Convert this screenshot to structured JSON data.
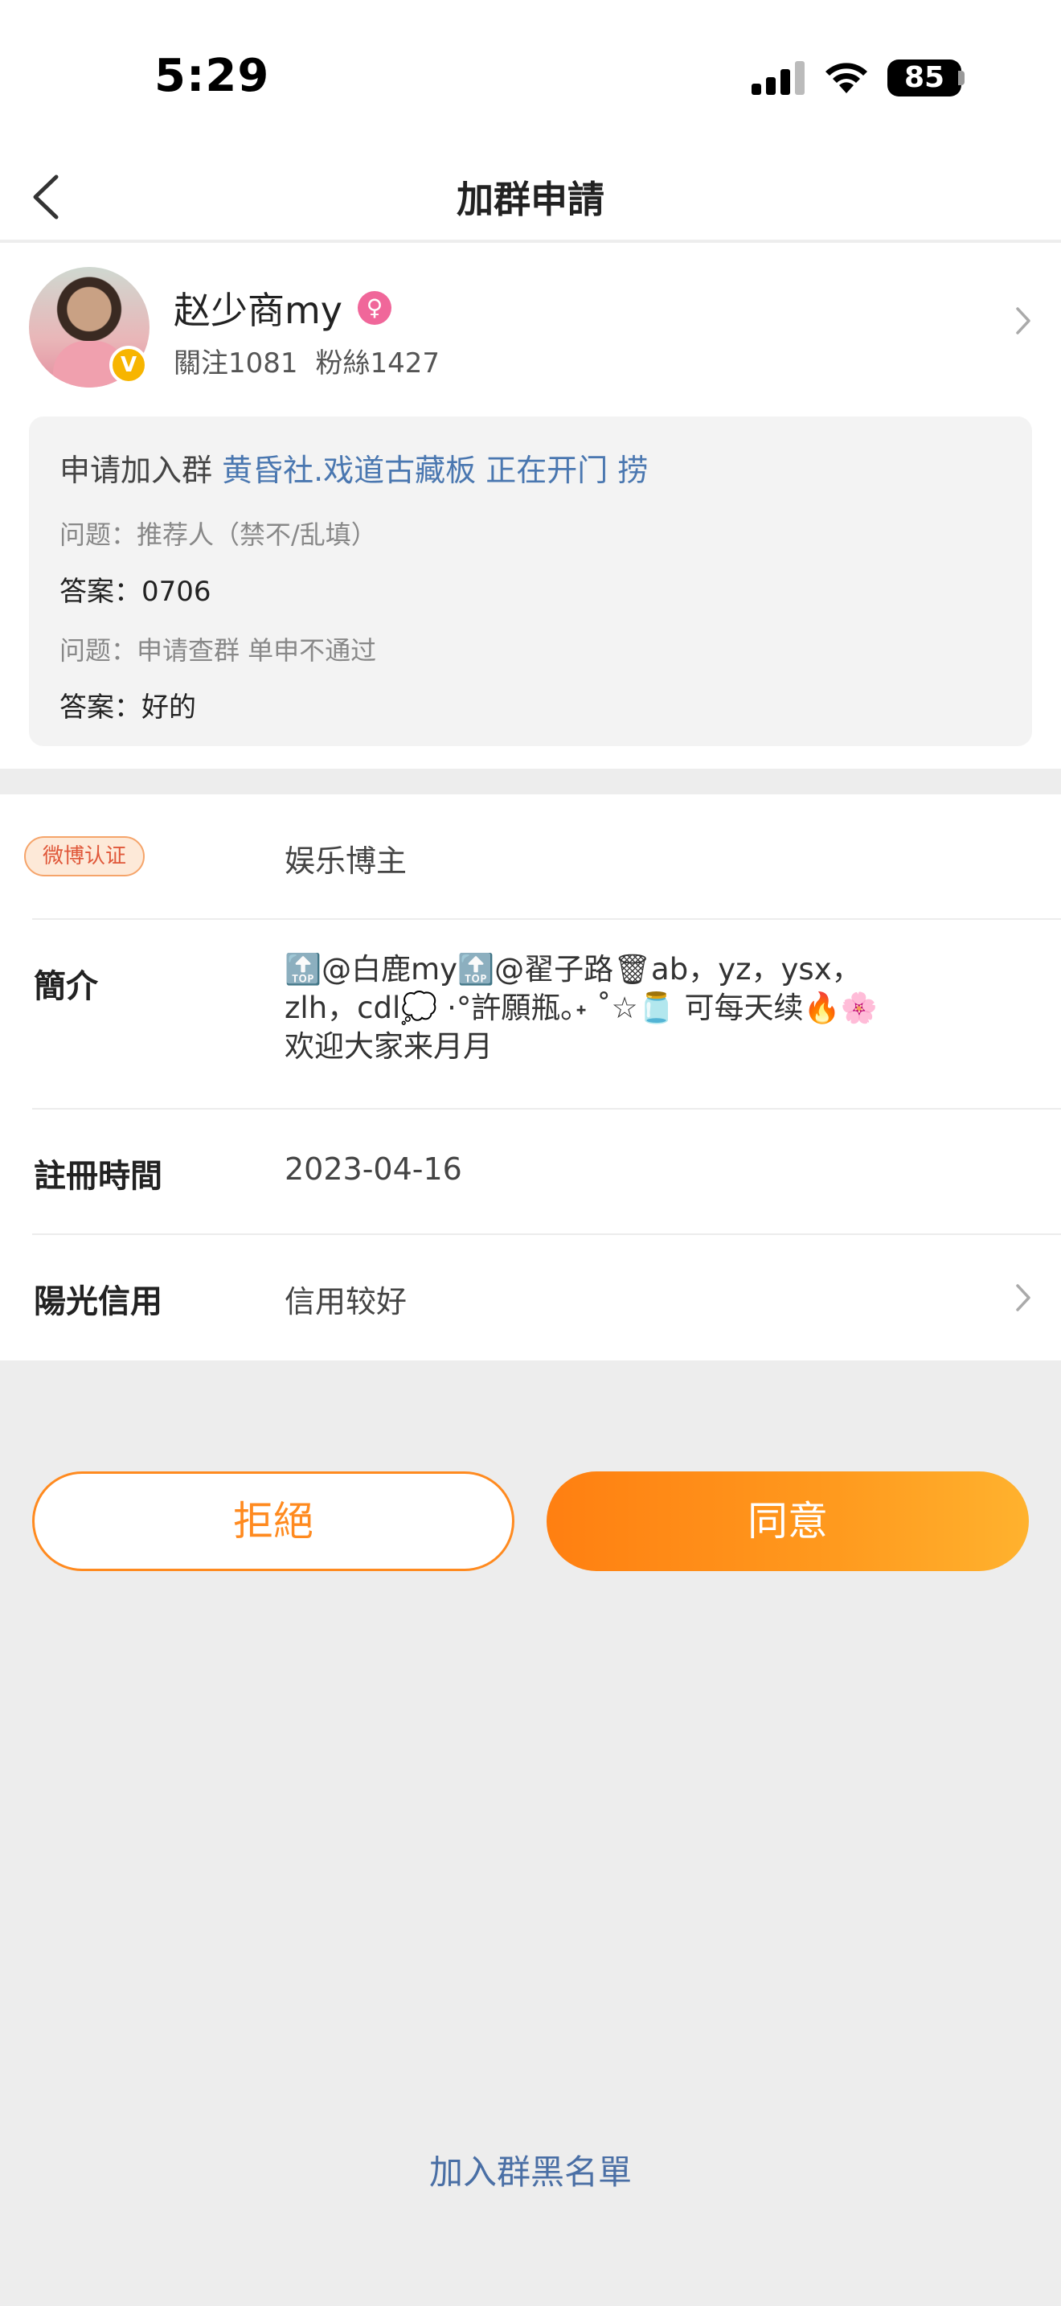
{
  "status_bar": {
    "time": "5:29",
    "battery": "85"
  },
  "nav": {
    "title": "加群申請"
  },
  "profile": {
    "username": "赵少商my",
    "gender_symbol": "♀",
    "follow": "關注1081",
    "fans": "粉絲1427",
    "verified_mark": "V"
  },
  "request": {
    "apply_prefix": "申请加入群 ",
    "group_name": "黄昏社.戏道古藏板 正在开门 捞",
    "question1": "问题：推荐人（禁不/乱填）",
    "answer1": "答案：0706",
    "question2": "问题：申请查群 单申不通过",
    "answer2": "答案：好的"
  },
  "info": {
    "weibo_badge": "微博认证",
    "weibo_value": "娱乐博主",
    "bio_label": "簡介",
    "bio_line1": "🔝@白鹿my🔝@翟子路🗑ab，yz，ysx，",
    "bio_line2": "zlh，cdl💭 ·°許願瓶｡˖ ˚☆🫙 可每天续🔥🌸",
    "bio_line3": "欢迎大家来月月",
    "reg_label": "註冊時間",
    "reg_value": "2023-04-16",
    "credit_label": "陽光信用",
    "credit_value": "信用较好"
  },
  "actions": {
    "reject": "拒絕",
    "agree": "同意",
    "blacklist": "加入群黑名單"
  },
  "colors": {
    "accent": "#ff8a1f",
    "link": "#4a77b0",
    "background": "#ededed"
  }
}
